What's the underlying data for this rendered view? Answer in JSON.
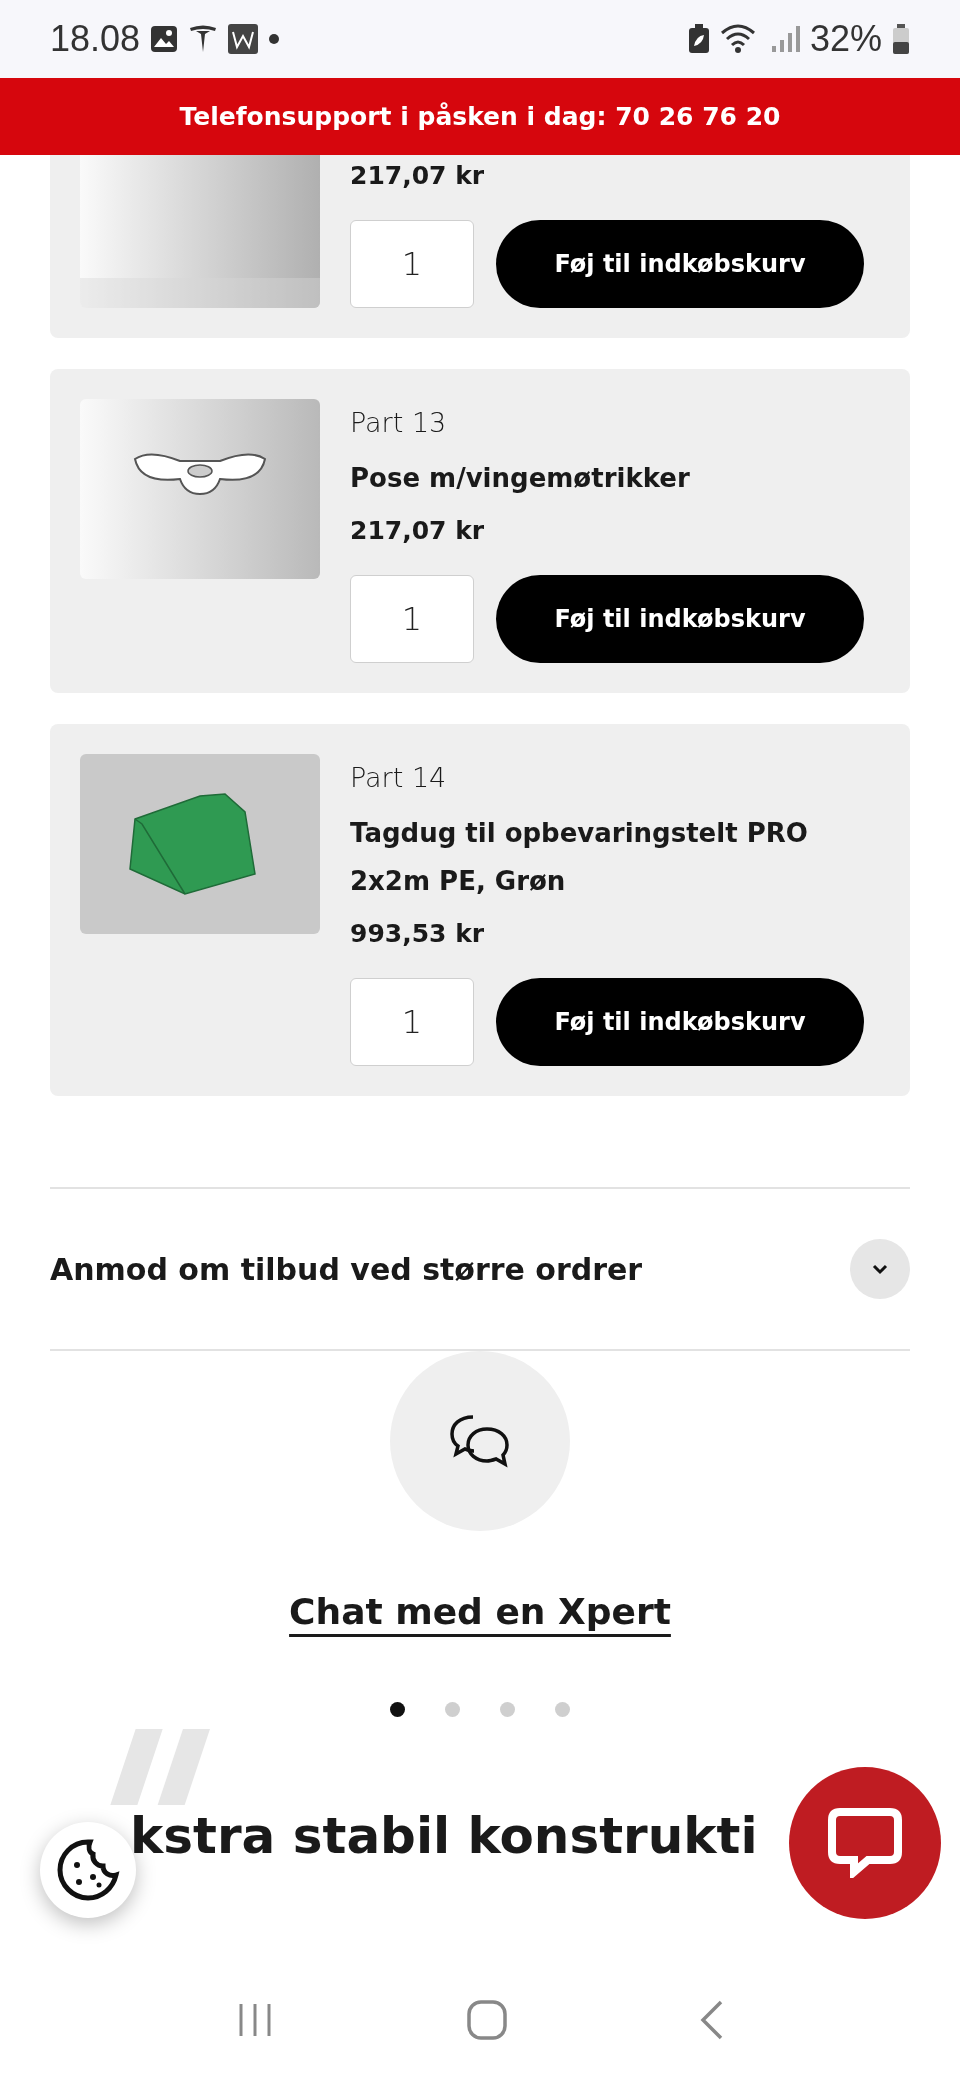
{
  "status_bar": {
    "time": "18.08",
    "battery": "32%"
  },
  "banner": {
    "text": "Telefonsupport i påsken i dag: 70 26 76 20"
  },
  "products": [
    {
      "clipped": true,
      "price": "217,07 kr",
      "quantity": "1",
      "button": "Føj til indkøbskurv"
    },
    {
      "clipped": false,
      "part": "Part 13",
      "title": "Pose m/vingemøtrikker",
      "price": "217,07 kr",
      "quantity": "1",
      "button": "Føj til indkøbskurv"
    },
    {
      "clipped": false,
      "part": "Part 14",
      "title": "Tagdug til opbevaringstelt PRO 2x2m PE, Grøn",
      "price": "993,53 kr",
      "quantity": "1",
      "button": "Føj til indkøbskurv"
    }
  ],
  "accordion": {
    "title": "Anmod om tilbud ved større ordrer",
    "expanded": false
  },
  "chat": {
    "link": "Chat med en Xpert"
  },
  "carousel_dots": [
    {
      "selected": true
    },
    {
      "selected": false
    },
    {
      "selected": false
    },
    {
      "selected": false
    }
  ],
  "heading": "kstra stabil konstrukti"
}
